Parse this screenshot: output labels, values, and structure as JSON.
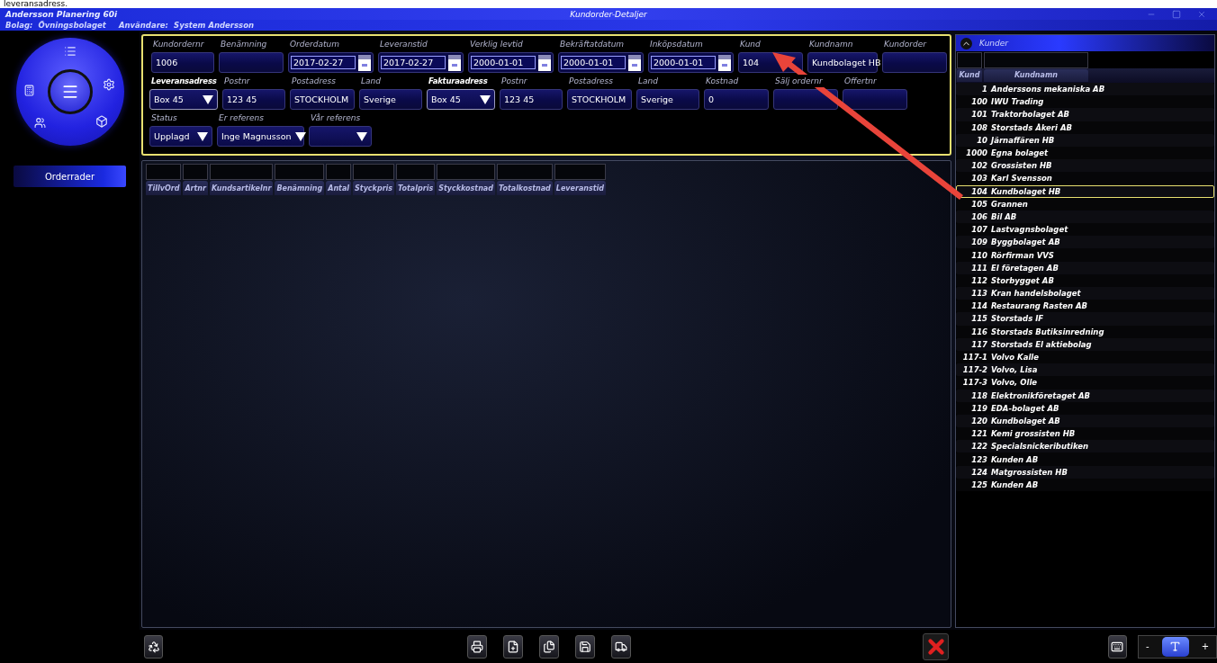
{
  "caption": "leveransadress.",
  "app": {
    "title": "Andersson Planering 60i",
    "company_label": "Bolag:",
    "company": "Övningsbolaget",
    "user_label": "Användare:",
    "user": "System Andersson"
  },
  "window": {
    "title": "Kundorder-Detaljer"
  },
  "side_menu": {
    "items": [
      {
        "label": "Orderrader",
        "selected": true
      }
    ]
  },
  "form": {
    "rows": [
      {
        "fields": [
          {
            "label": "Kundordernr",
            "value": "1006",
            "kind": "text"
          },
          {
            "label": "Benämning",
            "kind": "text"
          },
          {
            "label": "Orderdatum",
            "value": "2017-02-27",
            "kind": "date"
          },
          {
            "label": "Leveranstid",
            "value": "2017-02-27",
            "kind": "date"
          },
          {
            "label": "Verklig levtid",
            "value": "2000-01-01",
            "kind": "date"
          },
          {
            "label": "Bekräftatdatum",
            "value": "2000-01-01",
            "kind": "date"
          },
          {
            "label": "Inköpsdatum",
            "value": "2000-01-01",
            "kind": "date"
          },
          {
            "label": "Kund",
            "value": "104",
            "kind": "text"
          },
          {
            "label": "Kundnamn",
            "value": "Kundbolaget HB",
            "kind": "text"
          },
          {
            "label": "Kundorder",
            "kind": "text"
          }
        ]
      },
      {
        "fields": [
          {
            "label": "Leveransadress",
            "value": "Box 45",
            "kind": "dropdown",
            "bold": true
          },
          {
            "label": "Postnr",
            "value": "123 45",
            "kind": "text"
          },
          {
            "label": "Postadress",
            "value": "STOCKHOLM",
            "kind": "text"
          },
          {
            "label": "Land",
            "value": "Sverige",
            "kind": "text"
          },
          {
            "label": "Fakturaadress",
            "value": "Box 45",
            "kind": "dropdown",
            "bold": true
          },
          {
            "label": "Postnr",
            "value": "123 45",
            "kind": "text"
          },
          {
            "label": "Postadress",
            "value": "STOCKHOLM",
            "kind": "text"
          },
          {
            "label": "Land",
            "value": "Sverige",
            "kind": "text"
          },
          {
            "label": "Kostnad",
            "value": "0",
            "kind": "text"
          },
          {
            "label": "Sälj ordernr",
            "kind": "text"
          },
          {
            "label": "Offertnr",
            "kind": "text"
          }
        ]
      },
      {
        "fields": [
          {
            "label": "Status",
            "value": "Upplagd",
            "kind": "dropdown"
          },
          {
            "label": "Er referens",
            "value": "Inge Magnusson",
            "kind": "dropdown"
          },
          {
            "label": "Vår referens",
            "kind": "dropdown"
          }
        ]
      }
    ]
  },
  "order_rows": {
    "columns": [
      "TillvOrd",
      "Artnr",
      "Kundsartikelnr",
      "Benämning",
      "Antal",
      "Styckpris",
      "Totalpris",
      "Styckkostnad",
      "Totalkostnad",
      "Leveranstid"
    ]
  },
  "customers": {
    "title": "Kunder",
    "columns": [
      "Kund",
      "Kundnamn"
    ],
    "rows": [
      {
        "number": "1",
        "name": "Anderssons mekaniska AB",
        "selected": false
      },
      {
        "number": "100",
        "name": "IWU Trading",
        "selected": false
      },
      {
        "number": "101",
        "name": "Traktorbolaget AB",
        "selected": false
      },
      {
        "number": "108",
        "name": "Storstads Åkeri AB",
        "selected": false
      },
      {
        "number": "10",
        "name": "Järnaffären HB",
        "selected": false
      },
      {
        "number": "1000",
        "name": "Egna bolaget",
        "selected": false
      },
      {
        "number": "102",
        "name": "Grossisten HB",
        "selected": false
      },
      {
        "number": "103",
        "name": "Karl Svensson",
        "selected": false
      },
      {
        "number": "104",
        "name": "Kundbolaget HB",
        "selected": true
      },
      {
        "number": "105",
        "name": "Grannen",
        "selected": false
      },
      {
        "number": "106",
        "name": "Bil AB",
        "selected": false
      },
      {
        "number": "107",
        "name": "Lastvagnsbolaget",
        "selected": false
      },
      {
        "number": "109",
        "name": "Byggbolaget AB",
        "selected": false
      },
      {
        "number": "110",
        "name": "Rörfirman VVS",
        "selected": false
      },
      {
        "number": "111",
        "name": "El företagen AB",
        "selected": false
      },
      {
        "number": "112",
        "name": "Storbygget AB",
        "selected": false
      },
      {
        "number": "113",
        "name": "Kran handelsbolaget",
        "selected": false
      },
      {
        "number": "114",
        "name": "Restaurang Rasten AB",
        "selected": false
      },
      {
        "number": "115",
        "name": "Storstads IF",
        "selected": false
      },
      {
        "number": "116",
        "name": "Storstads Butiksinredning",
        "selected": false
      },
      {
        "number": "117",
        "name": "Storstads El aktiebolag",
        "selected": false
      },
      {
        "number": "117-1",
        "name": "Volvo Kalle",
        "selected": false
      },
      {
        "number": "117-2",
        "name": "Volvo, Lisa",
        "selected": false
      },
      {
        "number": "117-3",
        "name": "Volvo, Olle",
        "selected": false
      },
      {
        "number": "118",
        "name": "Elektronikföretaget AB",
        "selected": false
      },
      {
        "number": "119",
        "name": "EDA-bolaget AB",
        "selected": false
      },
      {
        "number": "120",
        "name": "Kundbolaget AB",
        "selected": false
      },
      {
        "number": "121",
        "name": "Kemi grossisten HB",
        "selected": false
      },
      {
        "number": "122",
        "name": "Specialsnickeributiken",
        "selected": false
      },
      {
        "number": "123",
        "name": "Kunden AB",
        "selected": false
      },
      {
        "number": "124",
        "name": "Matgrossisten HB",
        "selected": false
      },
      {
        "number": "125",
        "name": "Kunden AB",
        "selected": false
      }
    ]
  },
  "zoom": {
    "minus": "-",
    "plus": "+"
  }
}
